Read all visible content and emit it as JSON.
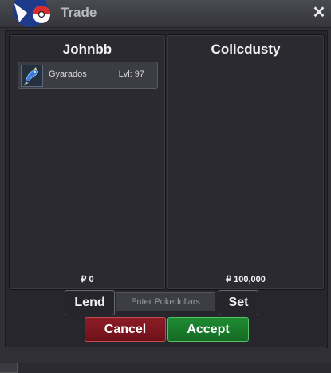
{
  "window": {
    "title": "Trade",
    "close_glyph": "✕"
  },
  "background_window": {
    "close_glyph": "✕"
  },
  "left_panel": {
    "player": "Johnbb",
    "items": [
      {
        "name": "Gyarados",
        "level": "Lvl: 97",
        "icon": "gyarados-sprite-icon"
      }
    ],
    "money": "₽ 0"
  },
  "right_panel": {
    "player": "Colicdusty",
    "items": [],
    "money": "₽ 100,000"
  },
  "controls": {
    "lend_label": "Lend",
    "pokedollars_placeholder": "Enter Pokedollars",
    "set_label": "Set",
    "cancel_label": "Cancel",
    "accept_label": "Accept"
  },
  "colors": {
    "cancel": "#8c1c26",
    "accept": "#1e8b32",
    "background": "#2a2a30"
  }
}
